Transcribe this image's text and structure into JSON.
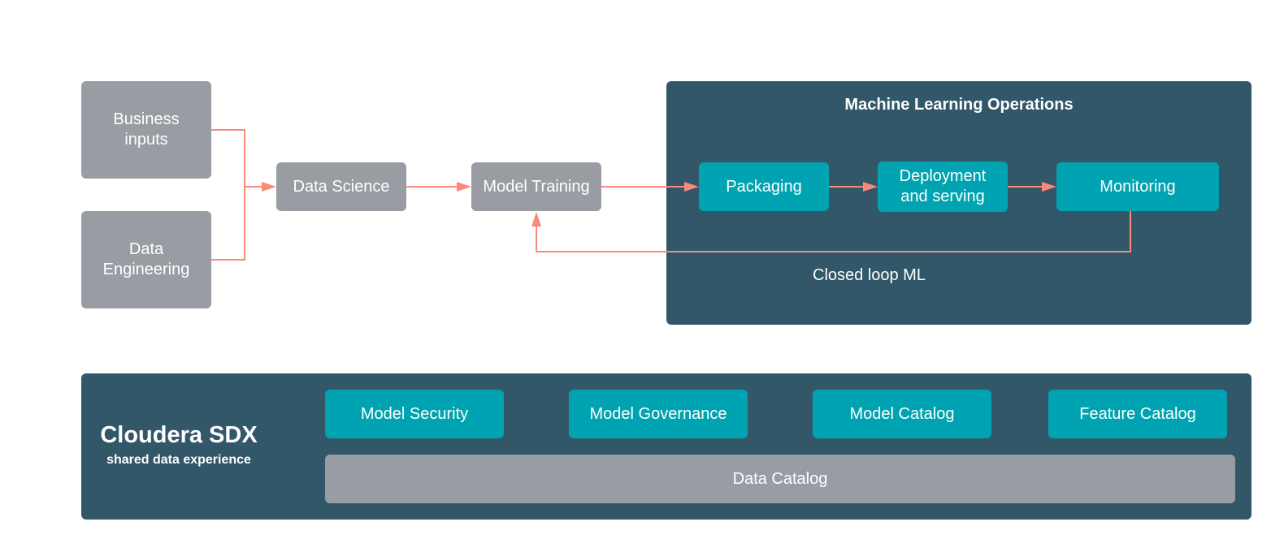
{
  "colors": {
    "gray_box": "#999da3",
    "teal_box": "#00a3b1",
    "dark_panel": "#325769",
    "arrow": "#f88a7c"
  },
  "inputs": {
    "business_inputs": "Business inputs",
    "data_engineering": "Data Engineering"
  },
  "pipeline": {
    "data_science": "Data Science",
    "model_training": "Model Training"
  },
  "mlops": {
    "title": "Machine Learning Operations",
    "stages": [
      "Packaging",
      "Deployment and serving",
      "Monitoring"
    ],
    "loop_label": "Closed loop ML"
  },
  "sdx": {
    "title": "Cloudera SDX",
    "subtitle": "shared data experience",
    "modules": [
      "Model Security",
      "Model Governance",
      "Model Catalog",
      "Feature Catalog"
    ],
    "foundation": "Data Catalog"
  }
}
